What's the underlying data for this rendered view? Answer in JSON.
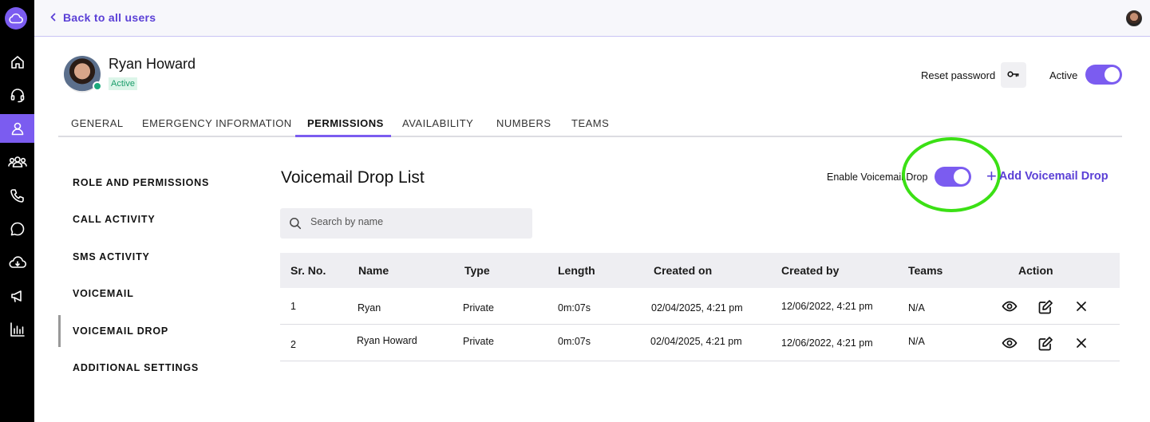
{
  "topbar": {
    "back_label": "Back to all users"
  },
  "sidebar_nav": [
    "home-icon",
    "headset-icon",
    "user-icon",
    "team-icon",
    "phone-icon",
    "chat-icon",
    "cloud-icon",
    "megaphone-icon",
    "analytics-icon"
  ],
  "user": {
    "name": "Ryan Howard",
    "status": "Active"
  },
  "header_actions": {
    "reset_password": "Reset password",
    "active_label": "Active",
    "active_on": true
  },
  "tabs": [
    "GENERAL",
    "EMERGENCY INFORMATION",
    "PERMISSIONS",
    "AVAILABILITY",
    "NUMBERS",
    "TEAMS"
  ],
  "active_tab": "PERMISSIONS",
  "side_menu": [
    "ROLE AND PERMISSIONS",
    "CALL ACTIVITY",
    "SMS ACTIVITY",
    "VOICEMAIL",
    "VOICEMAIL DROP",
    "ADDITIONAL SETTINGS"
  ],
  "active_side_item": "VOICEMAIL DROP",
  "section": {
    "title": "Voicemail Drop List",
    "enable_label": "Enable Voicemail Drop",
    "enable_on": true,
    "add_label": "Add Voicemail Drop"
  },
  "search": {
    "placeholder": "Search by name"
  },
  "table": {
    "columns": [
      "Sr. No.",
      "Name",
      "Type",
      "Length",
      "Created on",
      "Created by",
      "Teams",
      "Action"
    ],
    "rows": [
      {
        "sr": "1",
        "name": "Ryan",
        "type": "Private",
        "length": "0m:07s",
        "created_on": "02/04/2025, 4:21 pm",
        "created_by": "12/06/2022, 4:21 pm",
        "teams": "N/A"
      },
      {
        "sr": "2",
        "name": "Ryan Howard",
        "type": "Private",
        "length": "0m:07s",
        "created_on": "02/04/2025, 4:21 pm",
        "created_by": "12/06/2022, 4:21 pm",
        "teams": "N/A"
      }
    ]
  },
  "colors": {
    "accent": "#7b5cf0",
    "link": "#5a3fd6",
    "success": "#1ea97c",
    "highlight": "#3be015"
  }
}
